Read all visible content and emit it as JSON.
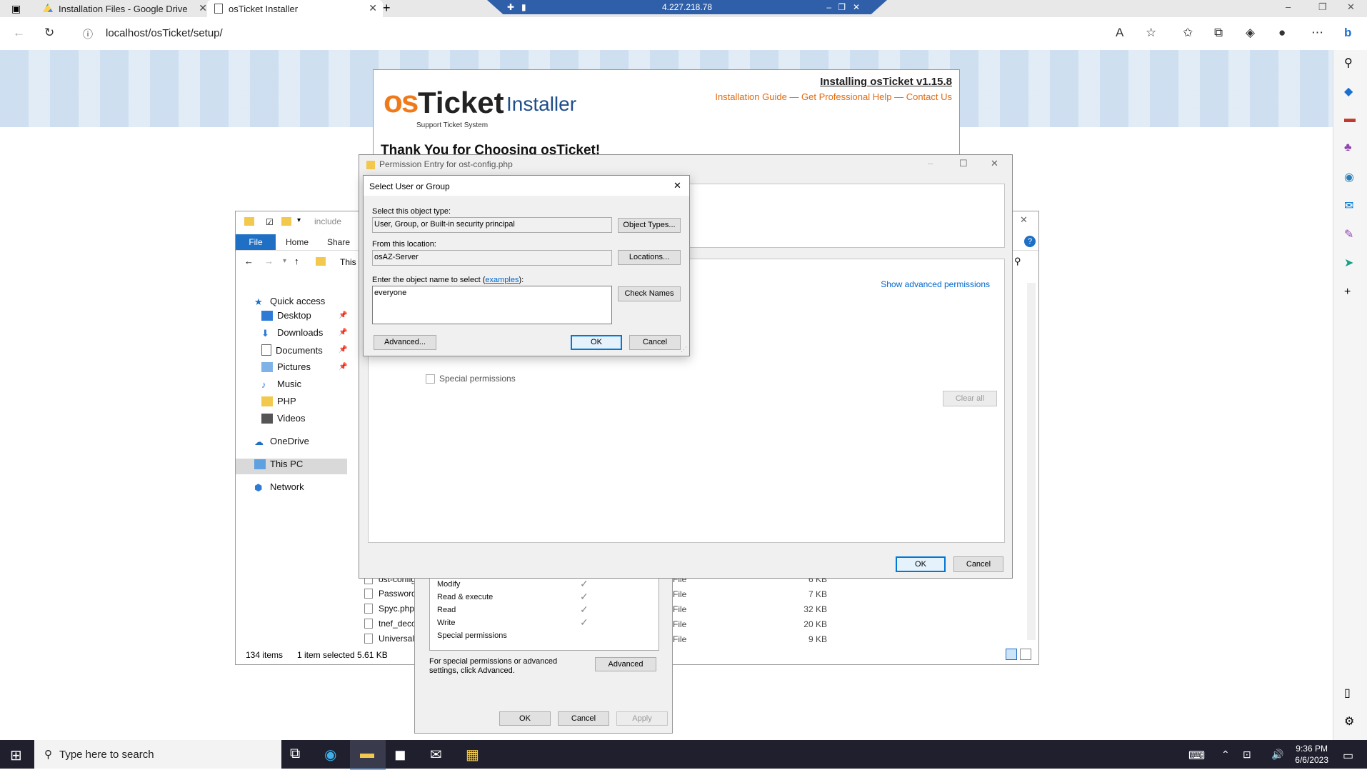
{
  "browser": {
    "tabs": [
      {
        "title": "Installation Files - Google Drive"
      },
      {
        "title": "osTicket Installer"
      }
    ],
    "rdp_ip": "4.227.218.78",
    "url": "localhost/osTicket/setup/"
  },
  "installer": {
    "logo_os": "os",
    "logo_ticket": "Ticket",
    "logo_installer": "Installer",
    "logo_sub": "Support Ticket System",
    "title": "Installing osTicket v1.15.8",
    "links": "Installation Guide — Get Professional Help — Contact Us",
    "thanks": "Thank You for Choosing osTicket!"
  },
  "explorer": {
    "path_label": "include",
    "ribbon_tabs": [
      "File",
      "Home",
      "Share"
    ],
    "breadcrumb": "This I",
    "nav": [
      {
        "label": "Quick access"
      },
      {
        "label": "Desktop"
      },
      {
        "label": "Downloads"
      },
      {
        "label": "Documents"
      },
      {
        "label": "Pictures"
      },
      {
        "label": "Music"
      },
      {
        "label": "PHP"
      },
      {
        "label": "Videos"
      },
      {
        "label": "OneDrive"
      },
      {
        "label": "This PC"
      },
      {
        "label": "Network"
      }
    ],
    "files": [
      {
        "name": "ost-config",
        "type": "File",
        "size": "6 KB"
      },
      {
        "name": "Password",
        "type": "File",
        "size": "7 KB"
      },
      {
        "name": "Spyc.php",
        "type": "File",
        "size": "32 KB"
      },
      {
        "name": "tnef_deco",
        "type": "File",
        "size": "20 KB"
      },
      {
        "name": "UniversalC",
        "type": "File",
        "size": "9 KB"
      }
    ],
    "status_items": "134 items",
    "status_selected": "1 item selected  5.61 KB"
  },
  "properties": {
    "perms": [
      "Modify",
      "Read & execute",
      "Read",
      "Write",
      "Special permissions"
    ],
    "note": "For special permissions or advanced settings, click Advanced.",
    "advanced": "Advanced",
    "ok": "OK",
    "cancel": "Cancel",
    "apply": "Apply"
  },
  "permission_entry": {
    "title": "Permission Entry for ost-config.php",
    "show_advanced": "Show advanced permissions",
    "special": "Special permissions",
    "clear_all": "Clear all",
    "ok": "OK",
    "cancel": "Cancel"
  },
  "select_user": {
    "title": "Select User or Group",
    "object_type_label": "Select this object type:",
    "object_type_value": "User, Group, or Built-in security principal",
    "object_types_btn": "Object Types...",
    "location_label": "From this location:",
    "location_value": "osAZ-Server",
    "locations_btn": "Locations...",
    "name_label_pre": "Enter the object name to select (",
    "name_label_link": "examples",
    "name_label_post": "):",
    "name_value": "everyone",
    "check_names_btn": "Check Names",
    "advanced_btn": "Advanced...",
    "ok": "OK",
    "cancel": "Cancel"
  },
  "taskbar": {
    "search_placeholder": "Type here to search",
    "time": "9:36 PM",
    "date": "6/6/2023"
  }
}
